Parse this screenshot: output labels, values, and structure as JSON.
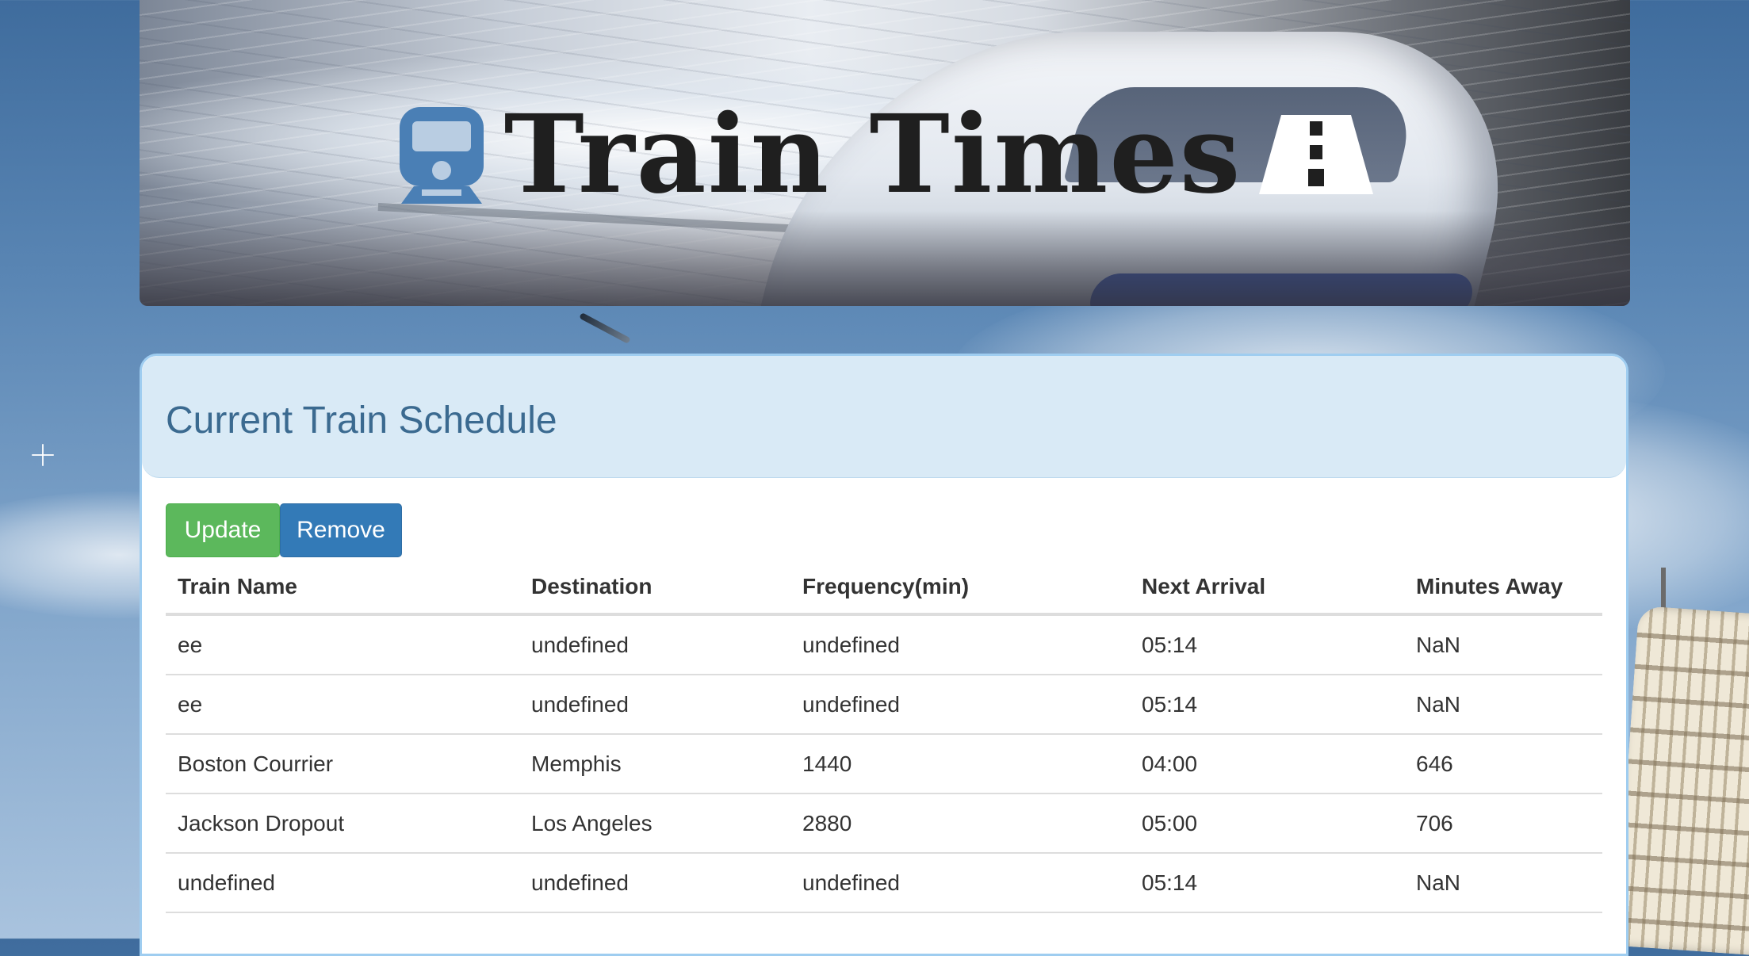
{
  "header": {
    "title": "Train Times",
    "left_icon": "train-icon",
    "right_icon": "road-icon"
  },
  "panel": {
    "title": "Current Train Schedule"
  },
  "actions": {
    "update_label": "Update",
    "remove_label": "Remove"
  },
  "table": {
    "columns": [
      "Train Name",
      "Destination",
      "Frequency(min)",
      "Next Arrival",
      "Minutes Away"
    ],
    "rows": [
      [
        "ee",
        "undefined",
        "undefined",
        "05:14",
        "NaN"
      ],
      [
        "ee",
        "undefined",
        "undefined",
        "05:14",
        "NaN"
      ],
      [
        "Boston Courrier",
        "Memphis",
        "1440",
        "04:00",
        "646"
      ],
      [
        "Jackson Dropout",
        "Los Angeles",
        "2880",
        "05:00",
        "706"
      ],
      [
        "undefined",
        "undefined",
        "undefined",
        "05:14",
        "NaN"
      ]
    ]
  },
  "colors": {
    "update_button": "#5cb85c",
    "remove_button": "#337ab7",
    "panel_heading_bg": "#d9eaf6",
    "panel_title": "#3b6a90",
    "panel_border": "#9fcdf0",
    "icon_blue": "#4a7fb5"
  }
}
